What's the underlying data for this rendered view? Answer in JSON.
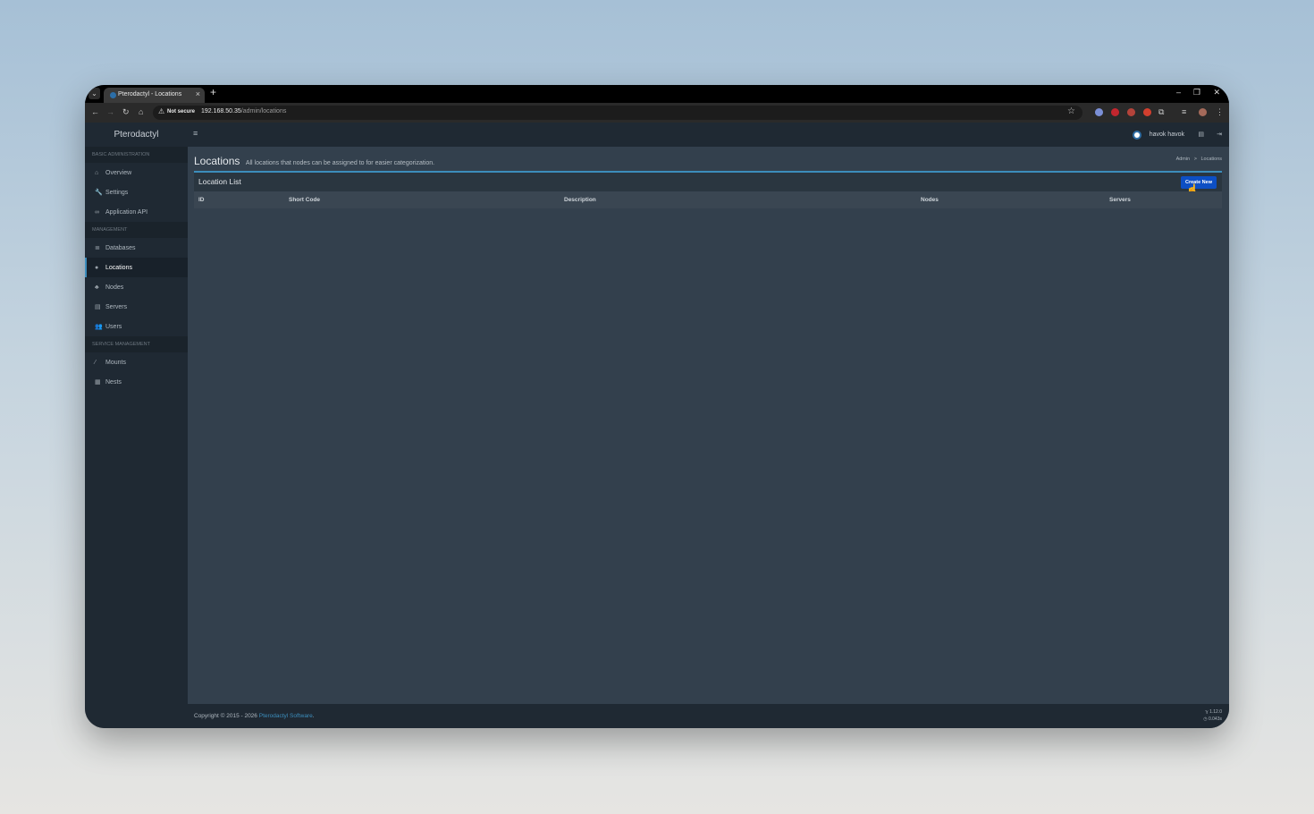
{
  "browser": {
    "tab_title": "Pterodactyl - Locations",
    "tab_close": "×",
    "new_tab": "+",
    "not_secure": "Not secure",
    "url_host": "192.168.50.35",
    "url_path": "/admin/locations"
  },
  "brand": "Pterodactyl",
  "sidebar": {
    "sections": [
      {
        "header": "Basic Administration",
        "items": [
          {
            "label": "Overview",
            "icon": "home-icon"
          },
          {
            "label": "Settings",
            "icon": "wrench-icon"
          },
          {
            "label": "Application API",
            "icon": "link-icon"
          }
        ]
      },
      {
        "header": "Management",
        "items": [
          {
            "label": "Databases",
            "icon": "database-icon"
          },
          {
            "label": "Locations",
            "icon": "globe-icon",
            "active": true
          },
          {
            "label": "Nodes",
            "icon": "sitemap-icon"
          },
          {
            "label": "Servers",
            "icon": "server-icon"
          },
          {
            "label": "Users",
            "icon": "users-icon"
          }
        ]
      },
      {
        "header": "Service Management",
        "items": [
          {
            "label": "Mounts",
            "icon": "magic-icon"
          },
          {
            "label": "Nests",
            "icon": "th-large-icon"
          }
        ]
      }
    ]
  },
  "topnav": {
    "username": "havok havok"
  },
  "header": {
    "title": "Locations",
    "subtitle": "All locations that nodes can be assigned to for easier categorization.",
    "breadcrumb": [
      "Admin",
      "Locations"
    ],
    "breadcrumb_sep": ">"
  },
  "box": {
    "title": "Location List",
    "create_label": "Create New",
    "columns": [
      "ID",
      "Short Code",
      "Description",
      "Nodes",
      "Servers"
    ]
  },
  "footer": {
    "copyright": "Copyright © 2015 - 2026 ",
    "link": "Pterodactyl Software",
    "link_suffix": ".",
    "version": "1.12.0",
    "timing": "0.043s"
  },
  "colors": {
    "accent": "#3c8dbc",
    "button": "#0d4fc4",
    "sidebar_bg": "#1f2933",
    "content_bg": "#33404d"
  }
}
